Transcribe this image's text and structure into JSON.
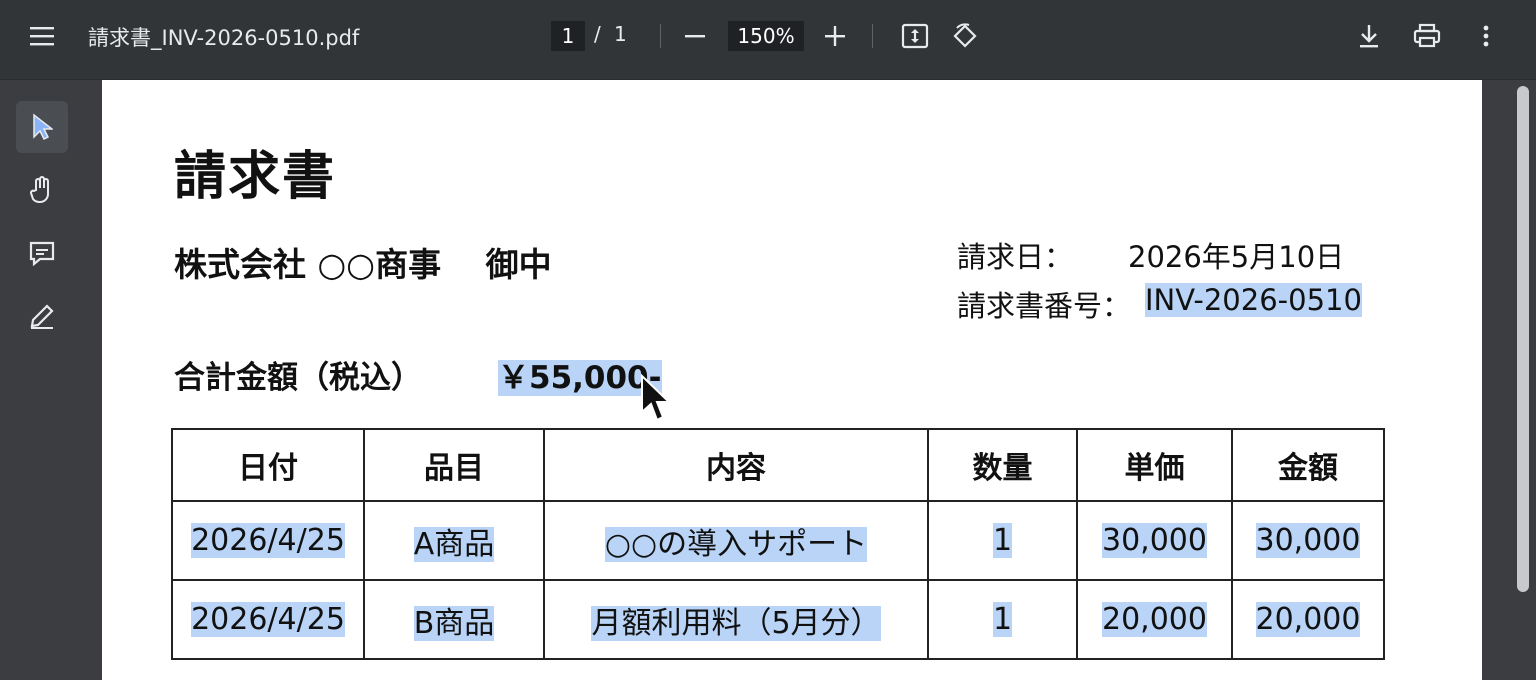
{
  "toolbar": {
    "filename": "請求書_INV-2026-0510.pdf",
    "current_page": "1",
    "page_separator": "/",
    "total_pages": "1",
    "zoom": "150%"
  },
  "invoice": {
    "title": "請求書",
    "recipient": "株式会社 ○○商事　 御中",
    "date_label": "請求日：",
    "date_value": "2026年5月10日",
    "number_label": "請求書番号：",
    "number_value": "INV-2026-0510",
    "total_label": "合計金額（税込）",
    "total_value": "￥55,000-"
  },
  "table": {
    "headers": [
      "日付",
      "品目",
      "内容",
      "数量",
      "単価",
      "金額"
    ],
    "rows": [
      [
        "2026/4/25",
        "A商品",
        "○○の導入サポート",
        "1",
        "30,000",
        "30,000"
      ],
      [
        "2026/4/25",
        "B商品",
        "月額利用料（5月分）",
        "1",
        "20,000",
        "20,000"
      ]
    ]
  },
  "colors": {
    "toolbar_bg": "#323538",
    "viewer_bg": "#3b3d41",
    "selection_highlight": "#b9d4f6"
  },
  "icons": {
    "menu": "menu-icon",
    "zoom_out": "minus-icon",
    "zoom_in": "plus-icon",
    "fit": "fit-page-icon",
    "rotate": "rotate-icon",
    "download": "download-icon",
    "print": "print-icon",
    "more": "more-vert-icon",
    "select_tool": "cursor-arrow-icon",
    "hand_tool": "hand-icon",
    "comment_tool": "comment-icon",
    "draw_tool": "pen-icon"
  }
}
